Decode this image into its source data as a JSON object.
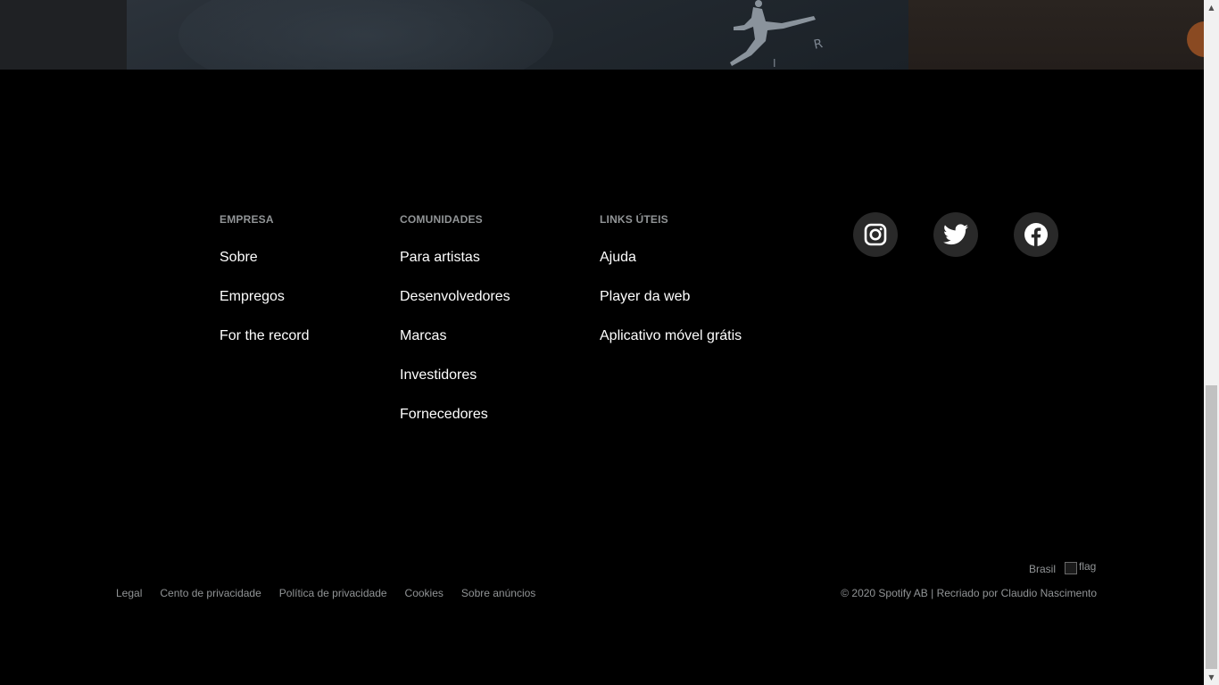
{
  "footer": {
    "columns": [
      {
        "heading": "EMPRESA",
        "links": [
          "Sobre",
          "Empregos",
          "For the record"
        ]
      },
      {
        "heading": "COMUNIDADES",
        "links": [
          "Para artistas",
          "Desenvolvedores",
          "Marcas",
          "Investidores",
          "Fornecedores"
        ]
      },
      {
        "heading": "LINKS ÚTEIS",
        "links": [
          "Ajuda",
          "Player da web",
          "Aplicativo móvel grátis"
        ]
      }
    ],
    "social": [
      {
        "icon": "instagram-icon"
      },
      {
        "icon": "twitter-icon"
      },
      {
        "icon": "facebook-icon"
      }
    ],
    "country": "Brasil",
    "flag_alt": "flag",
    "legal_links": [
      "Legal",
      "Cento de privacidade",
      "Política de privacidade",
      "Cookies",
      "Sobre anúncios"
    ],
    "copyright": "© 2020 Spotify AB | Recriado por Claudio Nascimento"
  },
  "colors": {
    "background": "#000000",
    "heading": "#919496",
    "link": "#ffffff",
    "social_circle": "#292929"
  }
}
